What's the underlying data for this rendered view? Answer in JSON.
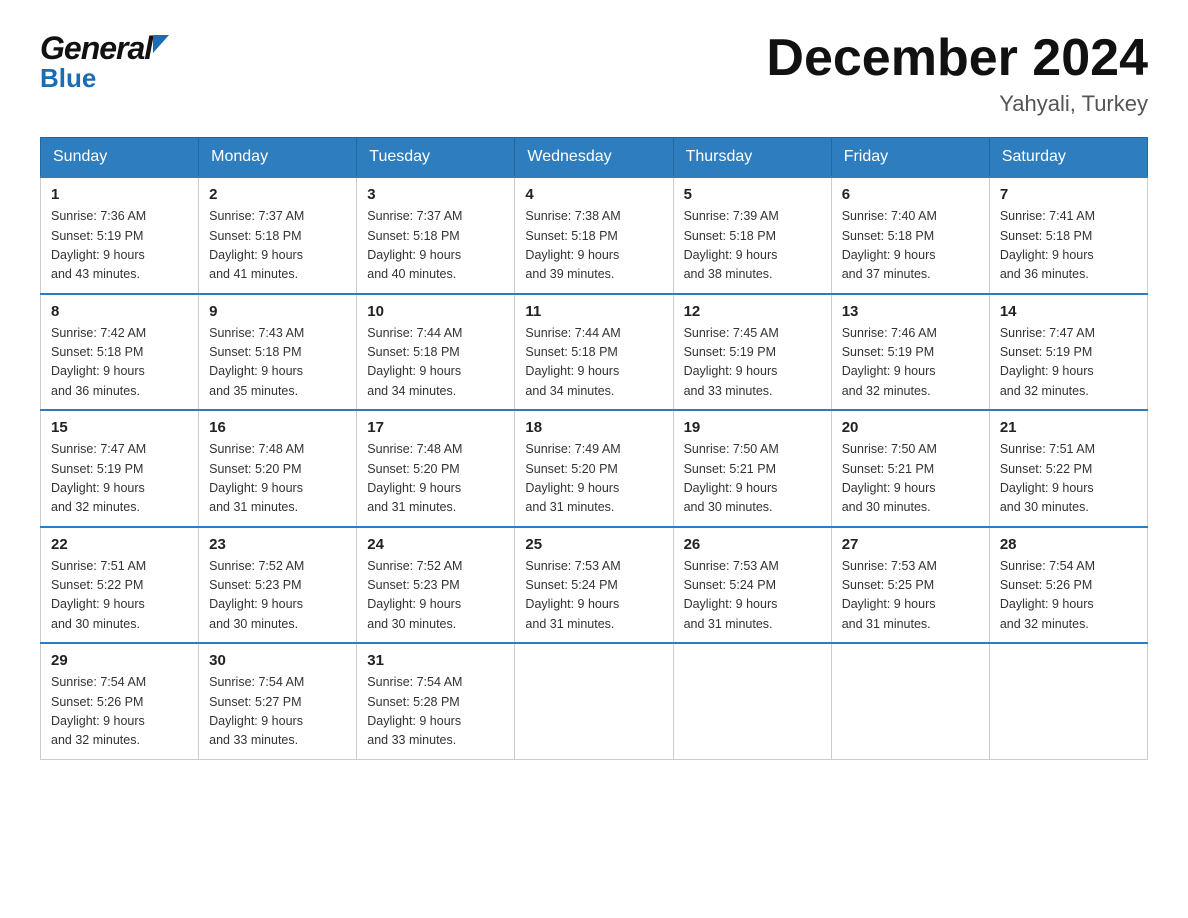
{
  "header": {
    "logo_general": "General",
    "logo_blue": "Blue",
    "month_year": "December 2024",
    "location": "Yahyali, Turkey"
  },
  "days_of_week": [
    "Sunday",
    "Monday",
    "Tuesday",
    "Wednesday",
    "Thursday",
    "Friday",
    "Saturday"
  ],
  "weeks": [
    {
      "days": [
        {
          "num": "1",
          "sunrise": "7:36 AM",
          "sunset": "5:19 PM",
          "daylight": "9 hours and 43 minutes."
        },
        {
          "num": "2",
          "sunrise": "7:37 AM",
          "sunset": "5:18 PM",
          "daylight": "9 hours and 41 minutes."
        },
        {
          "num": "3",
          "sunrise": "7:37 AM",
          "sunset": "5:18 PM",
          "daylight": "9 hours and 40 minutes."
        },
        {
          "num": "4",
          "sunrise": "7:38 AM",
          "sunset": "5:18 PM",
          "daylight": "9 hours and 39 minutes."
        },
        {
          "num": "5",
          "sunrise": "7:39 AM",
          "sunset": "5:18 PM",
          "daylight": "9 hours and 38 minutes."
        },
        {
          "num": "6",
          "sunrise": "7:40 AM",
          "sunset": "5:18 PM",
          "daylight": "9 hours and 37 minutes."
        },
        {
          "num": "7",
          "sunrise": "7:41 AM",
          "sunset": "5:18 PM",
          "daylight": "9 hours and 36 minutes."
        }
      ]
    },
    {
      "days": [
        {
          "num": "8",
          "sunrise": "7:42 AM",
          "sunset": "5:18 PM",
          "daylight": "9 hours and 36 minutes."
        },
        {
          "num": "9",
          "sunrise": "7:43 AM",
          "sunset": "5:18 PM",
          "daylight": "9 hours and 35 minutes."
        },
        {
          "num": "10",
          "sunrise": "7:44 AM",
          "sunset": "5:18 PM",
          "daylight": "9 hours and 34 minutes."
        },
        {
          "num": "11",
          "sunrise": "7:44 AM",
          "sunset": "5:18 PM",
          "daylight": "9 hours and 34 minutes."
        },
        {
          "num": "12",
          "sunrise": "7:45 AM",
          "sunset": "5:19 PM",
          "daylight": "9 hours and 33 minutes."
        },
        {
          "num": "13",
          "sunrise": "7:46 AM",
          "sunset": "5:19 PM",
          "daylight": "9 hours and 32 minutes."
        },
        {
          "num": "14",
          "sunrise": "7:47 AM",
          "sunset": "5:19 PM",
          "daylight": "9 hours and 32 minutes."
        }
      ]
    },
    {
      "days": [
        {
          "num": "15",
          "sunrise": "7:47 AM",
          "sunset": "5:19 PM",
          "daylight": "9 hours and 32 minutes."
        },
        {
          "num": "16",
          "sunrise": "7:48 AM",
          "sunset": "5:20 PM",
          "daylight": "9 hours and 31 minutes."
        },
        {
          "num": "17",
          "sunrise": "7:48 AM",
          "sunset": "5:20 PM",
          "daylight": "9 hours and 31 minutes."
        },
        {
          "num": "18",
          "sunrise": "7:49 AM",
          "sunset": "5:20 PM",
          "daylight": "9 hours and 31 minutes."
        },
        {
          "num": "19",
          "sunrise": "7:50 AM",
          "sunset": "5:21 PM",
          "daylight": "9 hours and 30 minutes."
        },
        {
          "num": "20",
          "sunrise": "7:50 AM",
          "sunset": "5:21 PM",
          "daylight": "9 hours and 30 minutes."
        },
        {
          "num": "21",
          "sunrise": "7:51 AM",
          "sunset": "5:22 PM",
          "daylight": "9 hours and 30 minutes."
        }
      ]
    },
    {
      "days": [
        {
          "num": "22",
          "sunrise": "7:51 AM",
          "sunset": "5:22 PM",
          "daylight": "9 hours and 30 minutes."
        },
        {
          "num": "23",
          "sunrise": "7:52 AM",
          "sunset": "5:23 PM",
          "daylight": "9 hours and 30 minutes."
        },
        {
          "num": "24",
          "sunrise": "7:52 AM",
          "sunset": "5:23 PM",
          "daylight": "9 hours and 30 minutes."
        },
        {
          "num": "25",
          "sunrise": "7:53 AM",
          "sunset": "5:24 PM",
          "daylight": "9 hours and 31 minutes."
        },
        {
          "num": "26",
          "sunrise": "7:53 AM",
          "sunset": "5:24 PM",
          "daylight": "9 hours and 31 minutes."
        },
        {
          "num": "27",
          "sunrise": "7:53 AM",
          "sunset": "5:25 PM",
          "daylight": "9 hours and 31 minutes."
        },
        {
          "num": "28",
          "sunrise": "7:54 AM",
          "sunset": "5:26 PM",
          "daylight": "9 hours and 32 minutes."
        }
      ]
    },
    {
      "days": [
        {
          "num": "29",
          "sunrise": "7:54 AM",
          "sunset": "5:26 PM",
          "daylight": "9 hours and 32 minutes."
        },
        {
          "num": "30",
          "sunrise": "7:54 AM",
          "sunset": "5:27 PM",
          "daylight": "9 hours and 33 minutes."
        },
        {
          "num": "31",
          "sunrise": "7:54 AM",
          "sunset": "5:28 PM",
          "daylight": "9 hours and 33 minutes."
        },
        null,
        null,
        null,
        null
      ]
    }
  ],
  "labels": {
    "sunrise": "Sunrise:",
    "sunset": "Sunset:",
    "daylight": "Daylight:"
  }
}
